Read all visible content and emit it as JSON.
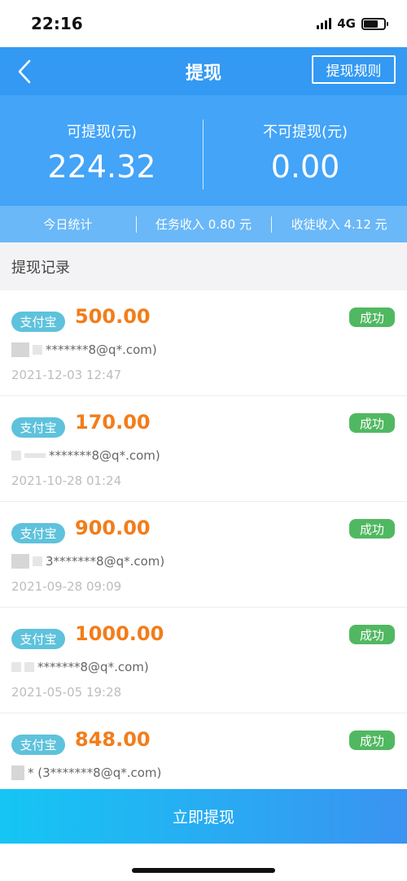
{
  "status_bar": {
    "time": "22:16",
    "network": "4G",
    "battery_level": 0.7
  },
  "navbar": {
    "title": "提现",
    "rules_label": "提现规则"
  },
  "summary": {
    "available_label": "可提现(元)",
    "available_value": "224.32",
    "unavailable_label": "不可提现(元)",
    "unavailable_value": "0.00"
  },
  "stats": {
    "today_label": "今日统计",
    "task_income": "任务收入 0.80 元",
    "recruit_income": "收徒收入 4.12 元"
  },
  "records_title": "提现记录",
  "records": [
    {
      "method": "支付宝",
      "amount": "500.00",
      "status": "成功",
      "account": "*******8@q*.com)",
      "date": "2021-12-03 12:47"
    },
    {
      "method": "支付宝",
      "amount": "170.00",
      "status": "成功",
      "account": "*******8@q*.com)",
      "date": "2021-10-28 01:24"
    },
    {
      "method": "支付宝",
      "amount": "900.00",
      "status": "成功",
      "account": "3*******8@q*.com)",
      "date": "2021-09-28 09:09"
    },
    {
      "method": "支付宝",
      "amount": "1000.00",
      "status": "成功",
      "account": "*******8@q*.com)",
      "date": "2021-05-05 19:28"
    },
    {
      "method": "支付宝",
      "amount": "848.00",
      "status": "成功",
      "account": "* (3*******8@q*.com)",
      "date": ""
    }
  ],
  "action_button": "立即提现",
  "colors": {
    "primary": "#3399f3",
    "amount": "#f27d1a",
    "success": "#51b862",
    "alipay": "#5ec2dc"
  }
}
